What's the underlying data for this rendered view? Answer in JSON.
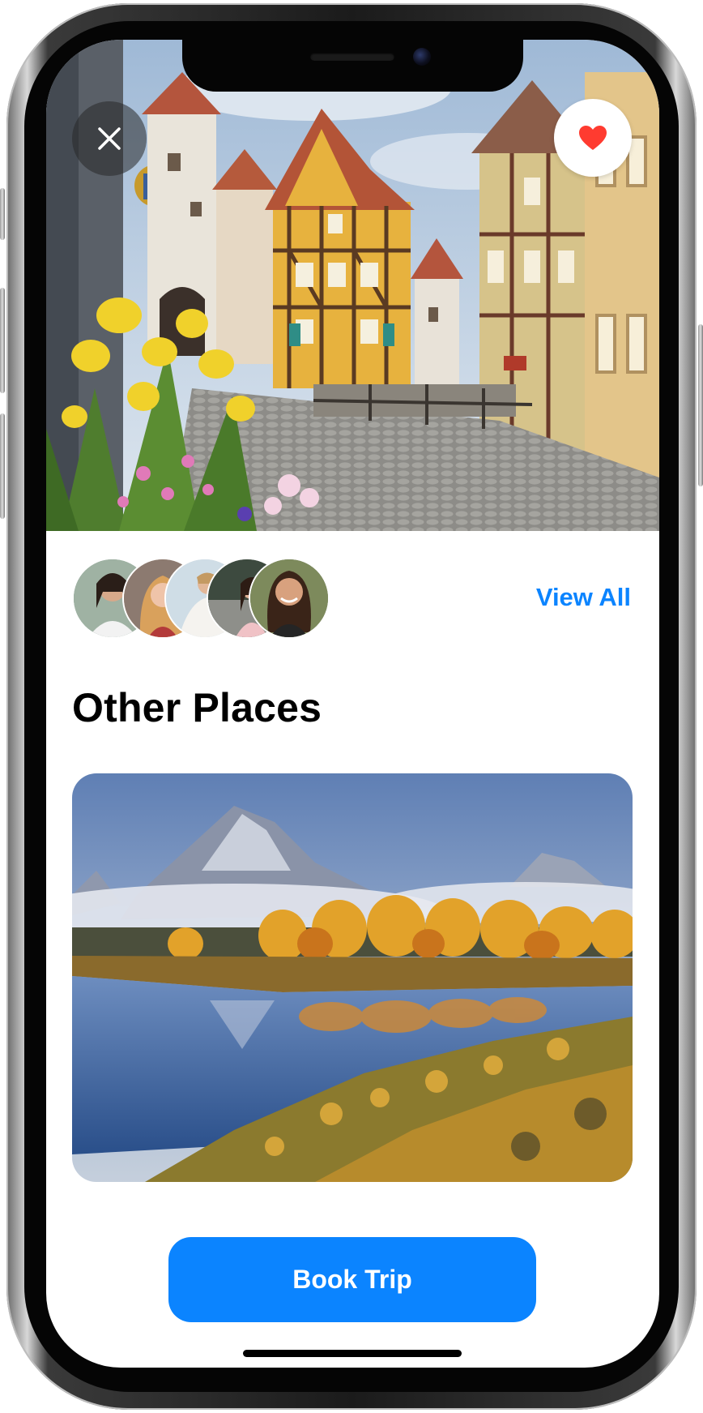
{
  "hero": {
    "image": "old-town-street-photo",
    "close_icon": "close-icon",
    "favorite_icon": "heart-icon",
    "favorite_color": "#ff3b30"
  },
  "travelers": {
    "avatars": [
      "traveler-1",
      "traveler-2",
      "traveler-3",
      "traveler-4",
      "traveler-5"
    ],
    "view_all_label": "View All"
  },
  "section": {
    "title": "Other Places"
  },
  "place_card": {
    "image": "mountain-lake-autumn-photo"
  },
  "actions": {
    "book_label": "Book Trip"
  },
  "colors": {
    "accent": "#0b84ff",
    "background": "#ffffff",
    "text": "#000000"
  }
}
